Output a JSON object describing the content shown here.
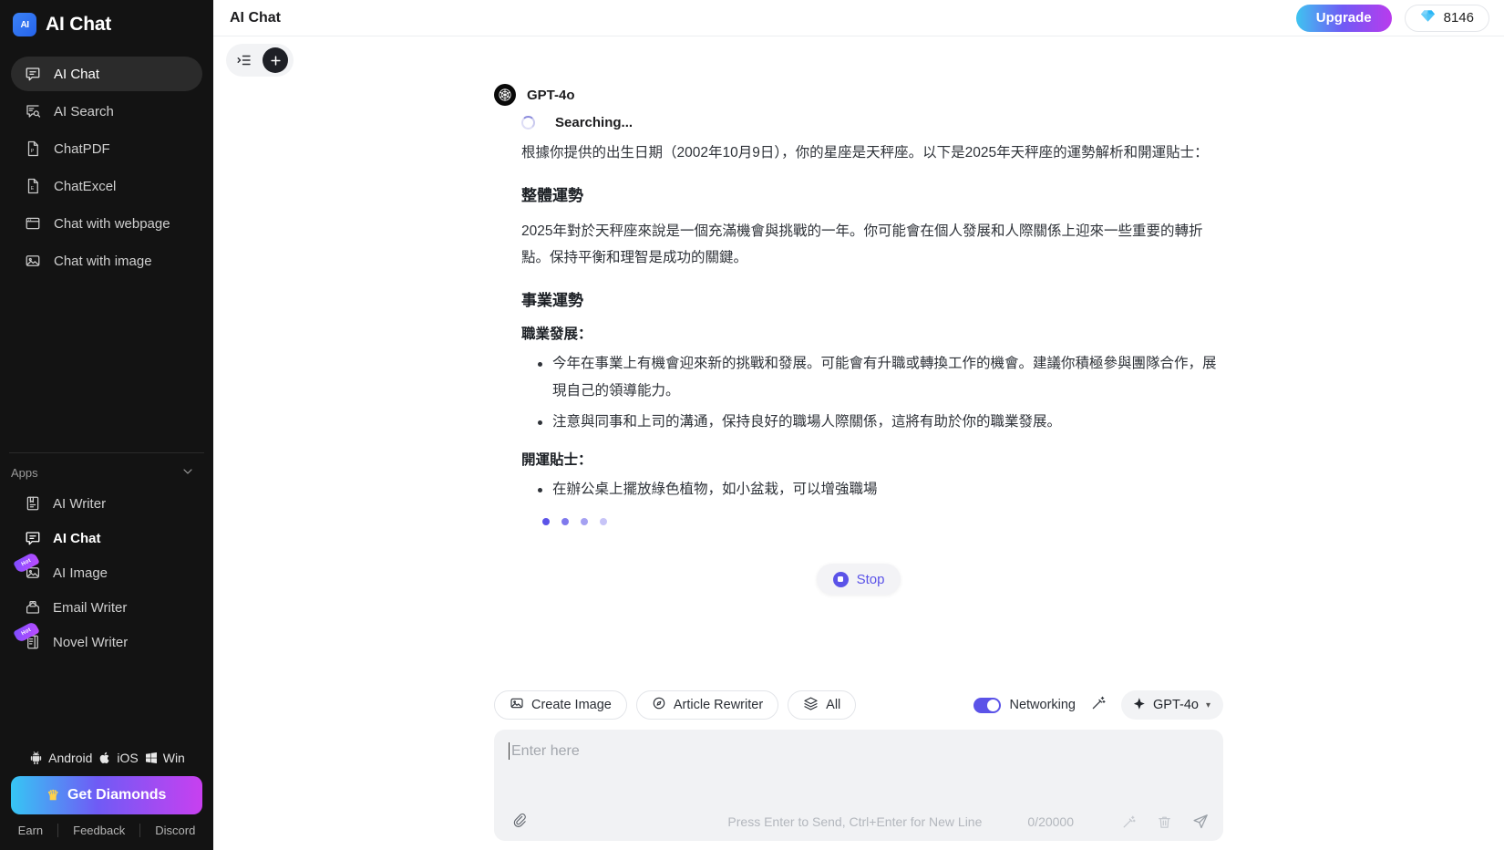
{
  "sidebar": {
    "brand": {
      "label": "AI Chat",
      "logo_text": "AI"
    },
    "nav": [
      {
        "label": "AI Chat",
        "icon": "chat-bubble-icon",
        "active": true
      },
      {
        "label": "AI Search",
        "icon": "search-doc-icon",
        "active": false
      },
      {
        "label": "ChatPDF",
        "icon": "pdf-file-icon",
        "active": false
      },
      {
        "label": "ChatExcel",
        "icon": "excel-file-icon",
        "active": false
      },
      {
        "label": "Chat with webpage",
        "icon": "browser-window-icon",
        "active": false
      },
      {
        "label": "Chat with image",
        "icon": "image-icon",
        "active": false
      }
    ],
    "apps_header": {
      "label": "Apps",
      "icon": "chevron-down-icon"
    },
    "apps": [
      {
        "label": "AI Writer",
        "icon": "writer-icon",
        "badge": "",
        "bold": false
      },
      {
        "label": "AI Chat",
        "icon": "chat-bubble-icon",
        "badge": "",
        "bold": true
      },
      {
        "label": "AI Image",
        "icon": "image-icon",
        "badge": "Hot",
        "bold": false
      },
      {
        "label": "Email Writer",
        "icon": "email-icon",
        "badge": "",
        "bold": false
      },
      {
        "label": "Novel Writer",
        "icon": "novel-icon",
        "badge": "Hot",
        "bold": false
      }
    ],
    "platforms": [
      {
        "label": "Android",
        "icon": "android-icon"
      },
      {
        "label": "iOS",
        "icon": "apple-icon"
      },
      {
        "label": "Win",
        "icon": "windows-icon"
      }
    ],
    "diamonds_button": {
      "label": "Get Diamonds",
      "icon": "crown-icon"
    },
    "footer_links": [
      "Earn",
      "Feedback",
      "Discord"
    ]
  },
  "topbar": {
    "title": "AI Chat",
    "upgrade_label": "Upgrade",
    "credits": "8146",
    "credits_icon": "diamond-icon"
  },
  "chat_tools": {
    "list_icon": "list-indent-icon",
    "add_icon": "plus-icon"
  },
  "message": {
    "model_name": "GPT-4o",
    "avatar_icon": "openai-logo-icon",
    "status": "Searching...",
    "intro": "根據你提供的出生日期（2002年10月9日），你的星座是天秤座。以下是2025年天秤座的運勢解析和開運貼士：",
    "sections": [
      {
        "heading": "整體運勢",
        "paragraph": "2025年對於天秤座來說是一個充滿機會與挑戰的一年。你可能會在個人發展和人際關係上迎來一些重要的轉折點。保持平衡和理智是成功的關鍵。"
      },
      {
        "heading": "事業運勢",
        "subheading": "職業發展：",
        "bullets": [
          "今年在事業上有機會迎來新的挑戰和發展。可能會有升職或轉換工作的機會。建議你積極參與團隊合作，展現自己的領導能力。",
          "注意與同事和上司的溝通，保持良好的職場人際關係，這將有助於你的職業發展。"
        ],
        "subheading2": "開運貼士：",
        "bullets2": [
          "在辦公桌上擺放綠色植物，如小盆栽，可以增強職場"
        ]
      }
    ]
  },
  "stop_button": {
    "label": "Stop",
    "icon": "stop-square-icon"
  },
  "composer": {
    "chips": [
      {
        "label": "Create Image",
        "icon": "image-icon"
      },
      {
        "label": "Article Rewriter",
        "icon": "rewrite-icon"
      },
      {
        "label": "All",
        "icon": "layers-icon"
      }
    ],
    "networking": {
      "label": "Networking",
      "enabled": true
    },
    "magic_icon": "magic-wand-icon",
    "model_selector": {
      "label": "GPT-4o",
      "icon": "sparkle-icon",
      "caret": "chevron-down-icon"
    },
    "input_placeholder": "Enter here",
    "attach_icon": "paperclip-icon",
    "hint": "Press Enter to Send, Ctrl+Enter for New Line",
    "counter": "0/20000",
    "footer_icons": [
      {
        "name": "magic-wand-icon"
      },
      {
        "name": "trash-icon"
      },
      {
        "name": "send-icon"
      }
    ]
  },
  "colors": {
    "accent": "#5b53e8",
    "sidebar_bg": "#131313",
    "upgrade_gradient_start": "#3fc4f0",
    "upgrade_gradient_end": "#b93bed"
  }
}
